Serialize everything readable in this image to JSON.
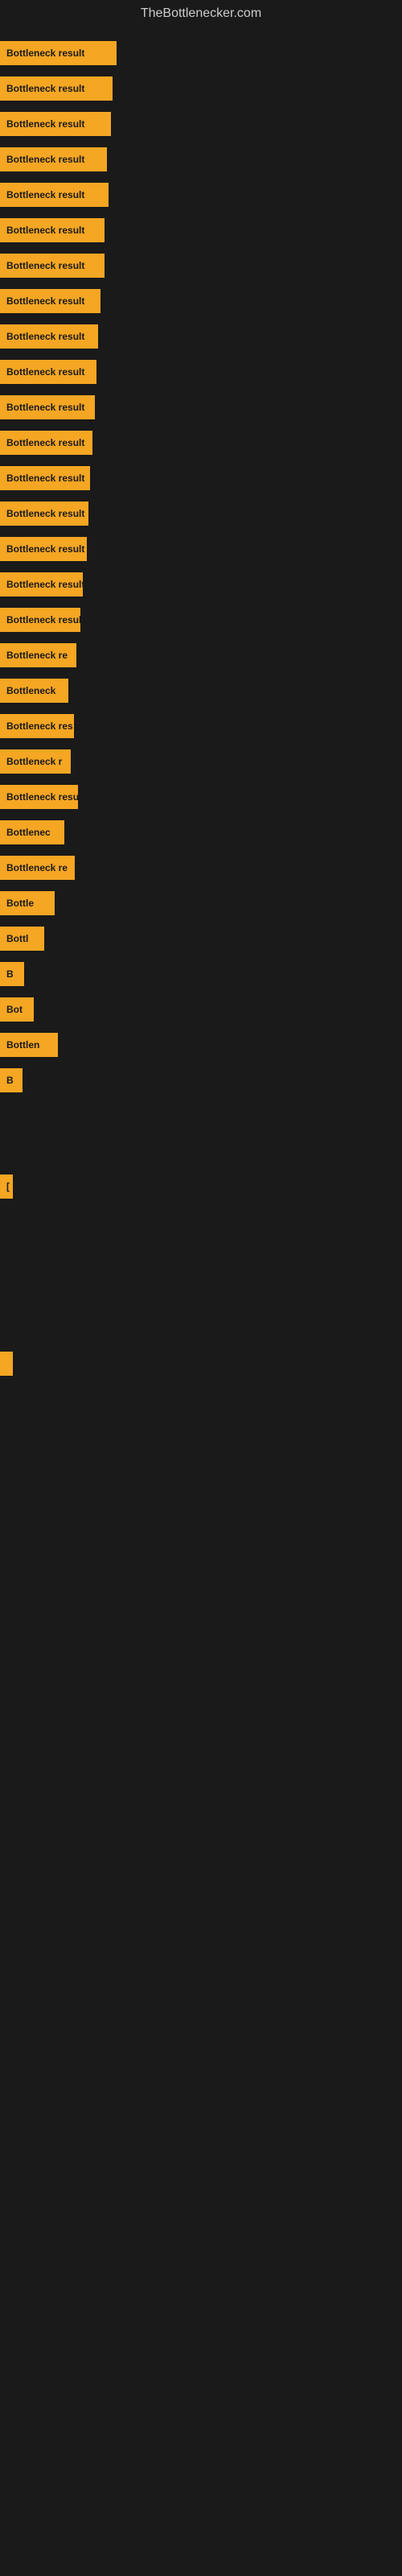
{
  "site": {
    "title": "TheBottlenecker.com"
  },
  "bars": [
    {
      "label": "Bottleneck result",
      "width": 145
    },
    {
      "label": "Bottleneck result",
      "width": 140
    },
    {
      "label": "Bottleneck result",
      "width": 138
    },
    {
      "label": "Bottleneck result",
      "width": 133
    },
    {
      "label": "Bottleneck result",
      "width": 135
    },
    {
      "label": "Bottleneck result",
      "width": 130
    },
    {
      "label": "Bottleneck result",
      "width": 130
    },
    {
      "label": "Bottleneck result",
      "width": 125
    },
    {
      "label": "Bottleneck result",
      "width": 122
    },
    {
      "label": "Bottleneck result",
      "width": 120
    },
    {
      "label": "Bottleneck result",
      "width": 118
    },
    {
      "label": "Bottleneck result",
      "width": 115
    },
    {
      "label": "Bottleneck result",
      "width": 112
    },
    {
      "label": "Bottleneck result",
      "width": 110
    },
    {
      "label": "Bottleneck result",
      "width": 108
    },
    {
      "label": "Bottleneck result",
      "width": 103
    },
    {
      "label": "Bottleneck result",
      "width": 100
    },
    {
      "label": "Bottleneck re",
      "width": 95
    },
    {
      "label": "Bottleneck",
      "width": 85
    },
    {
      "label": "Bottleneck res",
      "width": 92
    },
    {
      "label": "Bottleneck r",
      "width": 88
    },
    {
      "label": "Bottleneck resu",
      "width": 97
    },
    {
      "label": "Bottlenec",
      "width": 80
    },
    {
      "label": "Bottleneck re",
      "width": 93
    },
    {
      "label": "Bottle",
      "width": 68
    },
    {
      "label": "Bottl",
      "width": 55
    },
    {
      "label": "B",
      "width": 30
    },
    {
      "label": "Bot",
      "width": 42
    },
    {
      "label": "Bottlen",
      "width": 72
    },
    {
      "label": "B",
      "width": 28
    },
    {
      "label": "",
      "width": 0
    },
    {
      "label": "",
      "width": 0
    },
    {
      "label": "[",
      "width": 16
    },
    {
      "label": "",
      "width": 0
    },
    {
      "label": "",
      "width": 0
    },
    {
      "label": "",
      "width": 0
    },
    {
      "label": "",
      "width": 0
    },
    {
      "label": "",
      "width": 8
    }
  ]
}
